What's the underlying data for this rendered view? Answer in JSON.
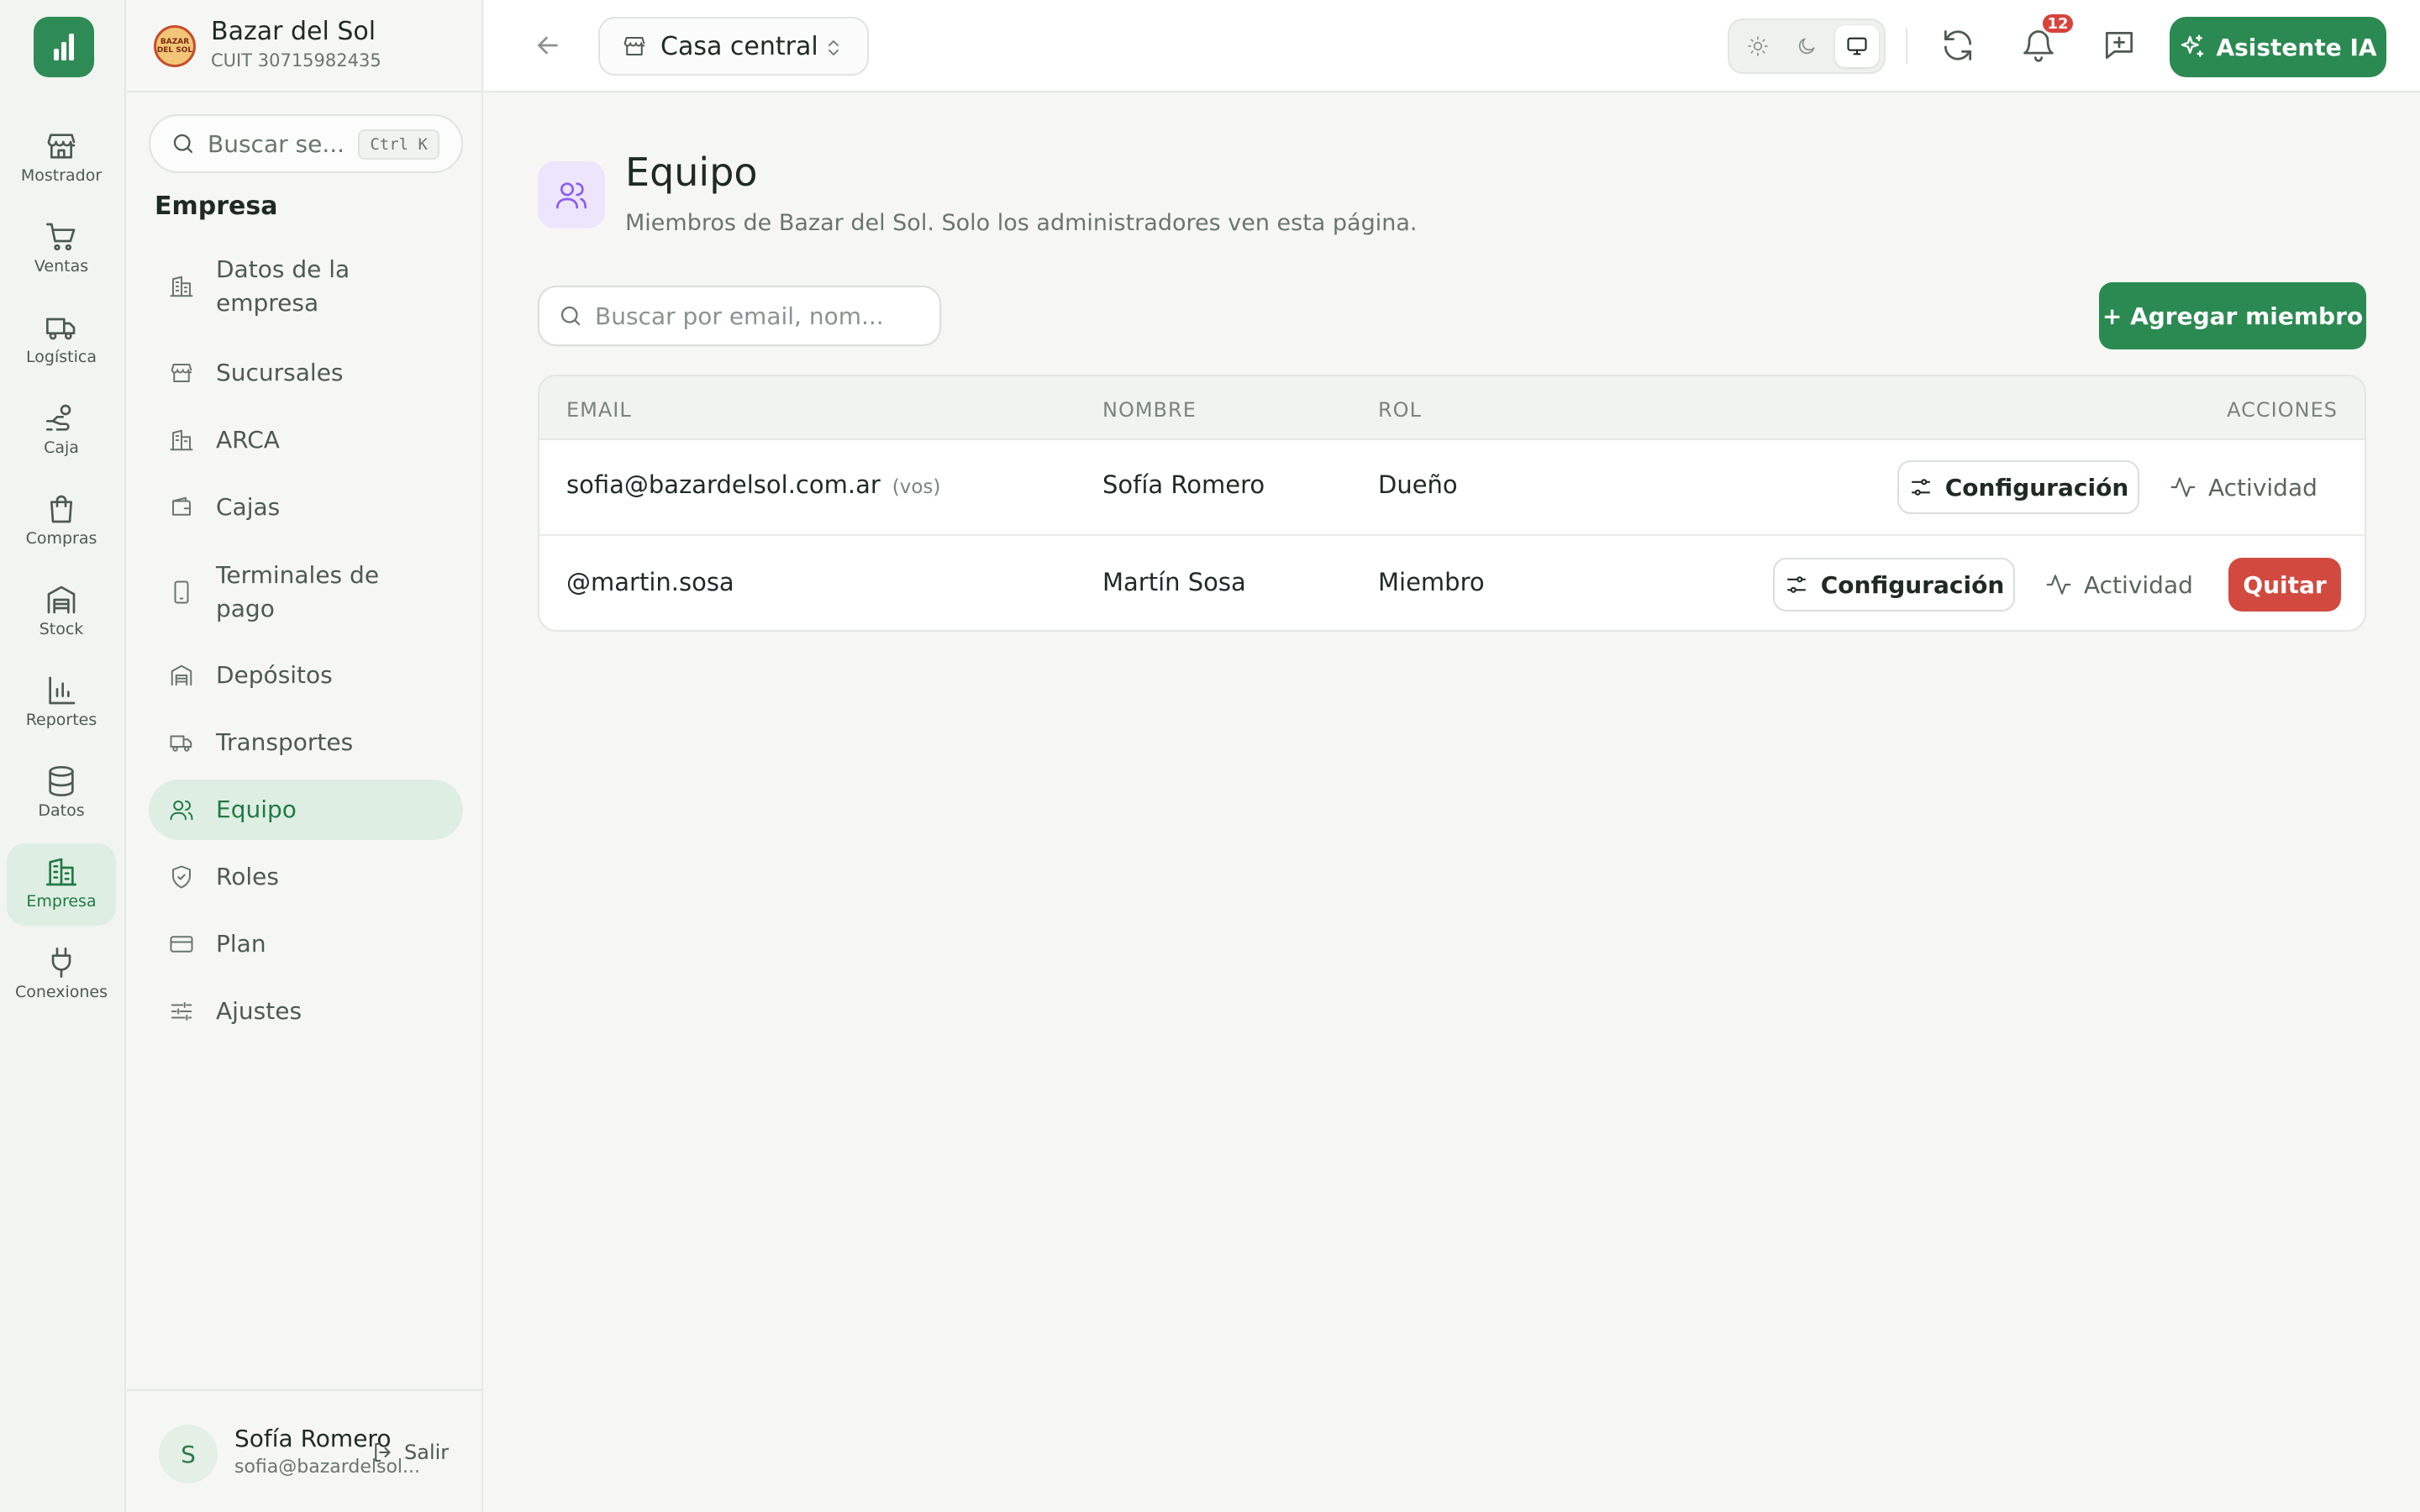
{
  "colors": {
    "accent": "#2b8a52",
    "accent_soft": "#dfeee3",
    "danger": "#d24a3f",
    "badge": "#d6443b",
    "page_icon_bg": "#ece5fb",
    "page_icon": "#8a5cf0"
  },
  "rail": {
    "items": [
      {
        "label": "Mostrador",
        "icon": "store-icon"
      },
      {
        "label": "Ventas",
        "icon": "cart-icon"
      },
      {
        "label": "Logística",
        "icon": "truck-icon"
      },
      {
        "label": "Caja",
        "icon": "hand-coins-icon"
      },
      {
        "label": "Compras",
        "icon": "shopping-bag-icon"
      },
      {
        "label": "Stock",
        "icon": "warehouse-icon"
      },
      {
        "label": "Reportes",
        "icon": "bar-chart-icon"
      },
      {
        "label": "Datos",
        "icon": "database-icon"
      },
      {
        "label": "Empresa",
        "icon": "building-icon",
        "active": true
      },
      {
        "label": "Conexiones",
        "icon": "plug-icon"
      }
    ]
  },
  "company": {
    "name": "Bazar del Sol",
    "cuit": "CUIT 30715982435",
    "logo_text": "BAZAR DEL SOL"
  },
  "panel": {
    "search_placeholder": "Buscar se...",
    "search_shortcut": "Ctrl K",
    "section_title": "Empresa",
    "items": [
      {
        "label": "Datos de la empresa",
        "icon": "building-icon"
      },
      {
        "label": "Sucursales",
        "icon": "store-icon"
      },
      {
        "label": "ARCA",
        "icon": "landmark-icon"
      },
      {
        "label": "Cajas",
        "icon": "wallet-icon"
      },
      {
        "label": "Terminales de pago",
        "icon": "smartphone-icon"
      },
      {
        "label": "Depósitos",
        "icon": "warehouse-icon"
      },
      {
        "label": "Transportes",
        "icon": "truck-icon"
      },
      {
        "label": "Equipo",
        "icon": "users-icon",
        "active": true
      },
      {
        "label": "Roles",
        "icon": "shield-icon"
      },
      {
        "label": "Plan",
        "icon": "credit-card-icon"
      },
      {
        "label": "Ajustes",
        "icon": "sliders-icon"
      }
    ]
  },
  "user": {
    "initial": "S",
    "name": "Sofía Romero",
    "email": "sofia@bazardelsol...",
    "logout_label": "Salir"
  },
  "topbar": {
    "branch": "Casa central",
    "notifications_count": "12",
    "ai_label": "Asistente IA",
    "theme_selected": "system"
  },
  "page": {
    "title": "Equipo",
    "subtitle": "Miembros de Bazar del Sol. Solo los administradores ven esta página.",
    "search_placeholder": "Buscar por email, nom...",
    "add_label": "+ Agregar miembro"
  },
  "table": {
    "headers": {
      "email": "EMAIL",
      "name": "NOMBRE",
      "role": "ROL",
      "actions": "ACCIONES"
    },
    "config_label": "Configuración",
    "activity_label": "Actividad",
    "remove_label": "Quitar",
    "rows": [
      {
        "email": "sofia@bazardelsol.com.ar",
        "tag": "(vos)",
        "name": "Sofía Romero",
        "role": "Dueño"
      },
      {
        "email": "@martin.sosa",
        "tag": "",
        "name": "Martín Sosa",
        "role": "Miembro"
      }
    ]
  }
}
